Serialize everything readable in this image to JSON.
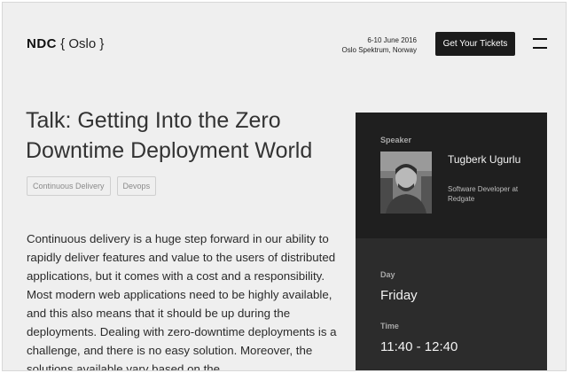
{
  "header": {
    "brand": "NDC",
    "city": "{ Oslo }",
    "dates": "6-10 June 2016",
    "venue": "Oslo Spektrum, Norway",
    "tickets_label": "Get Your Tickets"
  },
  "talk": {
    "title": "Talk: Getting Into the Zero Downtime Deployment World",
    "tags": [
      "Continuous Delivery",
      "Devops"
    ],
    "description": "Continuous delivery is a huge step forward in our ability to rapidly deliver features and value to the users of distributed applications, but it comes with a cost and a responsibility. Most modern web applications need to be highly available, and this also means that it should be up during the deployments. Dealing with zero-downtime deployments is a challenge, and there is no easy solution. Moreover, the solutions available vary based on the"
  },
  "speaker": {
    "section_label": "Speaker",
    "name": "Tugberk Ugurlu",
    "role": "Software Developer at Redgate"
  },
  "schedule": {
    "day_label": "Day",
    "day_value": "Friday",
    "time_label": "Time",
    "time_value": "11:40 - 12:40"
  },
  "colors": {
    "page_bg": "#efefef",
    "panel_bg": "#1f1f1f",
    "panel_lower_bg": "#2c2c2c",
    "button_bg": "#1b1b1b"
  },
  "icons": {
    "menu": "hamburger-menu-icon"
  }
}
